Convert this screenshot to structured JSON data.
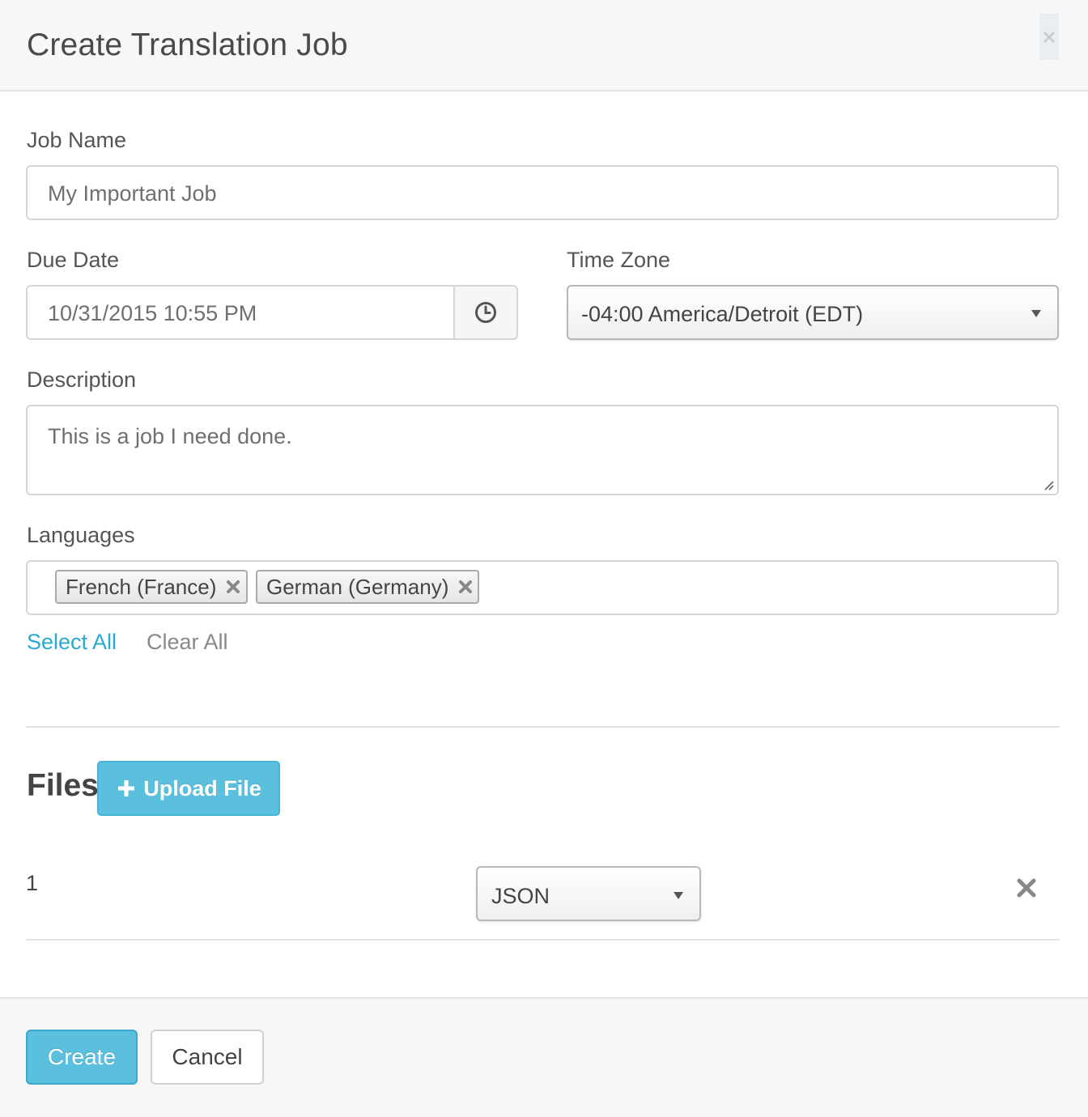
{
  "modal": {
    "title": "Create Translation Job",
    "close_icon": "close-icon"
  },
  "job_name": {
    "label": "Job Name",
    "value": "My Important Job"
  },
  "due_date": {
    "label": "Due Date",
    "value": "10/31/2015 10:55 PM",
    "addon_icon": "clock-icon"
  },
  "time_zone": {
    "label": "Time Zone",
    "selected": "-04:00 America/Detroit (EDT)"
  },
  "description": {
    "label": "Description",
    "value": "This is a job I need done."
  },
  "languages": {
    "label": "Languages",
    "selected": [
      {
        "label": "French (France)"
      },
      {
        "label": "German (Germany)"
      }
    ],
    "select_all_label": "Select All",
    "clear_all_label": "Clear All"
  },
  "files": {
    "title": "Files",
    "upload_label": "Upload File",
    "rows": [
      {
        "index": "1",
        "format": "JSON"
      }
    ]
  },
  "footer": {
    "create_label": "Create",
    "cancel_label": "Cancel"
  },
  "colors": {
    "accent": "#5bc0de",
    "link": "#2aa9cf",
    "muted_link": "#888888"
  }
}
